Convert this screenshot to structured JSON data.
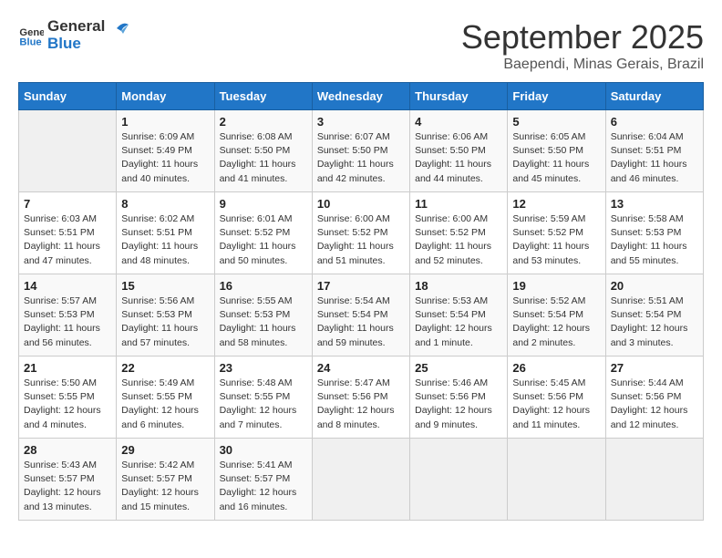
{
  "header": {
    "logo_line1": "General",
    "logo_line2": "Blue",
    "month": "September 2025",
    "location": "Baependi, Minas Gerais, Brazil"
  },
  "days_of_week": [
    "Sunday",
    "Monday",
    "Tuesday",
    "Wednesday",
    "Thursday",
    "Friday",
    "Saturday"
  ],
  "weeks": [
    [
      {
        "day": "",
        "info": ""
      },
      {
        "day": "1",
        "info": "Sunrise: 6:09 AM\nSunset: 5:49 PM\nDaylight: 11 hours\nand 40 minutes."
      },
      {
        "day": "2",
        "info": "Sunrise: 6:08 AM\nSunset: 5:50 PM\nDaylight: 11 hours\nand 41 minutes."
      },
      {
        "day": "3",
        "info": "Sunrise: 6:07 AM\nSunset: 5:50 PM\nDaylight: 11 hours\nand 42 minutes."
      },
      {
        "day": "4",
        "info": "Sunrise: 6:06 AM\nSunset: 5:50 PM\nDaylight: 11 hours\nand 44 minutes."
      },
      {
        "day": "5",
        "info": "Sunrise: 6:05 AM\nSunset: 5:50 PM\nDaylight: 11 hours\nand 45 minutes."
      },
      {
        "day": "6",
        "info": "Sunrise: 6:04 AM\nSunset: 5:51 PM\nDaylight: 11 hours\nand 46 minutes."
      }
    ],
    [
      {
        "day": "7",
        "info": "Sunrise: 6:03 AM\nSunset: 5:51 PM\nDaylight: 11 hours\nand 47 minutes."
      },
      {
        "day": "8",
        "info": "Sunrise: 6:02 AM\nSunset: 5:51 PM\nDaylight: 11 hours\nand 48 minutes."
      },
      {
        "day": "9",
        "info": "Sunrise: 6:01 AM\nSunset: 5:52 PM\nDaylight: 11 hours\nand 50 minutes."
      },
      {
        "day": "10",
        "info": "Sunrise: 6:00 AM\nSunset: 5:52 PM\nDaylight: 11 hours\nand 51 minutes."
      },
      {
        "day": "11",
        "info": "Sunrise: 6:00 AM\nSunset: 5:52 PM\nDaylight: 11 hours\nand 52 minutes."
      },
      {
        "day": "12",
        "info": "Sunrise: 5:59 AM\nSunset: 5:52 PM\nDaylight: 11 hours\nand 53 minutes."
      },
      {
        "day": "13",
        "info": "Sunrise: 5:58 AM\nSunset: 5:53 PM\nDaylight: 11 hours\nand 55 minutes."
      }
    ],
    [
      {
        "day": "14",
        "info": "Sunrise: 5:57 AM\nSunset: 5:53 PM\nDaylight: 11 hours\nand 56 minutes."
      },
      {
        "day": "15",
        "info": "Sunrise: 5:56 AM\nSunset: 5:53 PM\nDaylight: 11 hours\nand 57 minutes."
      },
      {
        "day": "16",
        "info": "Sunrise: 5:55 AM\nSunset: 5:53 PM\nDaylight: 11 hours\nand 58 minutes."
      },
      {
        "day": "17",
        "info": "Sunrise: 5:54 AM\nSunset: 5:54 PM\nDaylight: 11 hours\nand 59 minutes."
      },
      {
        "day": "18",
        "info": "Sunrise: 5:53 AM\nSunset: 5:54 PM\nDaylight: 12 hours\nand 1 minute."
      },
      {
        "day": "19",
        "info": "Sunrise: 5:52 AM\nSunset: 5:54 PM\nDaylight: 12 hours\nand 2 minutes."
      },
      {
        "day": "20",
        "info": "Sunrise: 5:51 AM\nSunset: 5:54 PM\nDaylight: 12 hours\nand 3 minutes."
      }
    ],
    [
      {
        "day": "21",
        "info": "Sunrise: 5:50 AM\nSunset: 5:55 PM\nDaylight: 12 hours\nand 4 minutes."
      },
      {
        "day": "22",
        "info": "Sunrise: 5:49 AM\nSunset: 5:55 PM\nDaylight: 12 hours\nand 6 minutes."
      },
      {
        "day": "23",
        "info": "Sunrise: 5:48 AM\nSunset: 5:55 PM\nDaylight: 12 hours\nand 7 minutes."
      },
      {
        "day": "24",
        "info": "Sunrise: 5:47 AM\nSunset: 5:56 PM\nDaylight: 12 hours\nand 8 minutes."
      },
      {
        "day": "25",
        "info": "Sunrise: 5:46 AM\nSunset: 5:56 PM\nDaylight: 12 hours\nand 9 minutes."
      },
      {
        "day": "26",
        "info": "Sunrise: 5:45 AM\nSunset: 5:56 PM\nDaylight: 12 hours\nand 11 minutes."
      },
      {
        "day": "27",
        "info": "Sunrise: 5:44 AM\nSunset: 5:56 PM\nDaylight: 12 hours\nand 12 minutes."
      }
    ],
    [
      {
        "day": "28",
        "info": "Sunrise: 5:43 AM\nSunset: 5:57 PM\nDaylight: 12 hours\nand 13 minutes."
      },
      {
        "day": "29",
        "info": "Sunrise: 5:42 AM\nSunset: 5:57 PM\nDaylight: 12 hours\nand 15 minutes."
      },
      {
        "day": "30",
        "info": "Sunrise: 5:41 AM\nSunset: 5:57 PM\nDaylight: 12 hours\nand 16 minutes."
      },
      {
        "day": "",
        "info": ""
      },
      {
        "day": "",
        "info": ""
      },
      {
        "day": "",
        "info": ""
      },
      {
        "day": "",
        "info": ""
      }
    ]
  ]
}
